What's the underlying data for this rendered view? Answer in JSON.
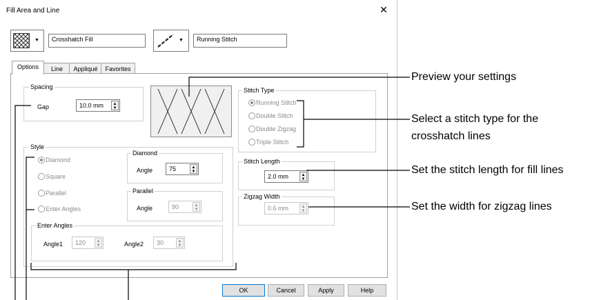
{
  "dialog": {
    "title": "Fill Area and Line",
    "fill_type_value": "Crosshatch Fill",
    "line_type_value": "Running Stitch",
    "tabs": [
      {
        "label": "Options"
      },
      {
        "label": "Line"
      },
      {
        "label": "Appliqué"
      },
      {
        "label": "Favorites"
      }
    ],
    "spacing": {
      "group_label": "Spacing",
      "gap_label": "Gap",
      "gap_value": "10.0 mm"
    },
    "style": {
      "group_label": "Style",
      "options": [
        "Diamond",
        "Square",
        "Parallel",
        "Enter Angles"
      ],
      "selected": "Diamond"
    },
    "diamond": {
      "group_label": "Diamond",
      "angle_label": "Angle",
      "angle_value": "75"
    },
    "parallel": {
      "group_label": "Parallel",
      "angle_label": "Angle",
      "angle_value": "90"
    },
    "enter_angles": {
      "group_label": "Enter Angles",
      "angle1_label": "Angle1",
      "angle1_value": "120",
      "angle2_label": "Angle2",
      "angle2_value": "30"
    },
    "stitch_type": {
      "group_label": "Stitch Type",
      "options": [
        "Running Stitch",
        "Double Stitch",
        "Double Zigzag",
        "Triple Stitch"
      ],
      "selected": "Running Stitch"
    },
    "stitch_length": {
      "group_label": "Stitch Length",
      "value": "2.0 mm"
    },
    "zigzag_width": {
      "group_label": "Zigzag Width",
      "value": "0.6 mm"
    },
    "buttons": {
      "ok": "OK",
      "cancel": "Cancel",
      "apply": "Apply",
      "help": "Help"
    }
  },
  "callouts": {
    "preview": "Preview your settings",
    "stitch_type_line1": "Select a stitch type for the",
    "stitch_type_line2": "crosshatch lines",
    "stitch_length": "Set the stitch length for fill lines",
    "zigzag_width": "Set the width for zigzag lines"
  },
  "icons": {
    "close": "close-icon",
    "fill_type": "crosshatch-fill-icon",
    "line_type": "running-stitch-line-icon",
    "dropdown": "chevron-down-icon",
    "spin_up": "spin-up-icon",
    "spin_down": "spin-down-icon"
  }
}
